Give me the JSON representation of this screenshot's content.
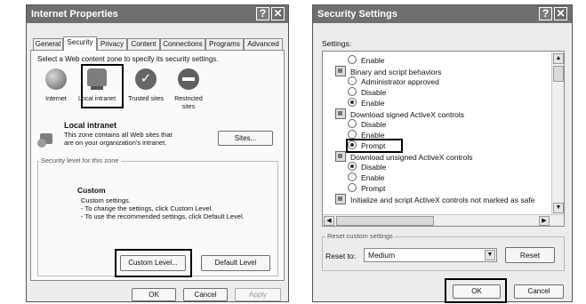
{
  "internet_properties": {
    "title": "Internet Properties",
    "help_icon": "?",
    "close_icon": "✕",
    "tabs": [
      "General",
      "Security",
      "Privacy",
      "Content",
      "Connections",
      "Programs",
      "Advanced"
    ],
    "select_zone_text": "Select a Web content zone to specify its security settings.",
    "zones": [
      {
        "label": "Internet",
        "icon": "globe-icon"
      },
      {
        "label": "Local intranet",
        "icon": "computer-icon"
      },
      {
        "label": "Trusted sites",
        "icon": "checkmark-icon"
      },
      {
        "label": "Restricted sites",
        "icon": "no-entry-icon"
      }
    ],
    "zone_heading": "Local intranet",
    "zone_desc_1": "This zone contains all Web sites that",
    "zone_desc_2": "are on your organization's intranet.",
    "sites_button": "Sites...",
    "security_level_group": "Security level for this zone",
    "level_title": "Custom",
    "level_line_1": "Custom settings.",
    "level_line_2": "- To change the settings, click Custom Level.",
    "level_line_3": "- To use the recommended settings, click Default Level.",
    "custom_level_button": "Custom Level...",
    "default_level_button": "Default Level",
    "ok_button": "OK",
    "cancel_button": "Cancel",
    "apply_button": "Apply"
  },
  "security_settings": {
    "title": "Security Settings",
    "help_icon": "?",
    "close_icon": "✕",
    "settings_label": "Settings:",
    "items": [
      {
        "kind": "radio",
        "label": "Enable",
        "checked": false
      },
      {
        "kind": "category",
        "label": "Binary and script behaviors"
      },
      {
        "kind": "radio",
        "label": "Administrator approved",
        "checked": false
      },
      {
        "kind": "radio",
        "label": "Disable",
        "checked": false
      },
      {
        "kind": "radio",
        "label": "Enable",
        "checked": true
      },
      {
        "kind": "category",
        "label": "Download signed ActiveX controls"
      },
      {
        "kind": "radio",
        "label": "Disable",
        "checked": false
      },
      {
        "kind": "radio",
        "label": "Enable",
        "checked": false
      },
      {
        "kind": "radio",
        "label": "Prompt",
        "checked": true
      },
      {
        "kind": "category",
        "label": "Download unsigned ActiveX controls"
      },
      {
        "kind": "radio",
        "label": "Disable",
        "checked": true
      },
      {
        "kind": "radio",
        "label": "Enable",
        "checked": false
      },
      {
        "kind": "radio",
        "label": "Prompt",
        "checked": false
      },
      {
        "kind": "category",
        "label": "Initialize and script ActiveX controls not marked as safe"
      }
    ],
    "reset_group": "Reset custom settings",
    "reset_to_label": "Reset to:",
    "reset_to_value": "Medium",
    "reset_button": "Reset",
    "ok_button": "OK",
    "cancel_button": "Cancel"
  }
}
